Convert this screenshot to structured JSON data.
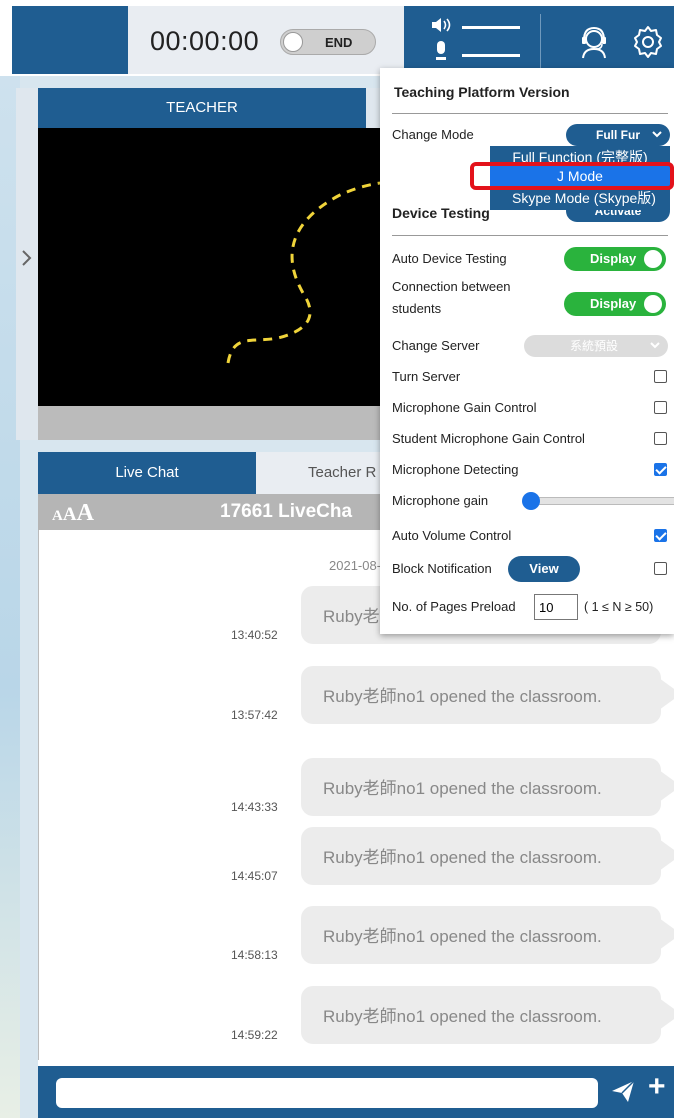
{
  "topbar": {
    "timer": "00:00:00",
    "end_label": "END"
  },
  "teacher": {
    "tab_label": "TEACHER"
  },
  "chat": {
    "tabs": [
      {
        "label": "Live Chat"
      },
      {
        "label": "Teacher R"
      }
    ],
    "font_size_label": [
      "A",
      "A",
      "A"
    ],
    "room_title": "17661 LiveCha",
    "date_stamp": "2021-08-",
    "messages": [
      {
        "time": "13:40:52",
        "text": "Ruby老"
      },
      {
        "time": "13:57:42",
        "text": "Ruby老師no1 opened the classroom."
      },
      {
        "time": "14:43:33",
        "text": "Ruby老師no1 opened the classroom."
      },
      {
        "time": "14:45:07",
        "text": "Ruby老師no1 opened the classroom."
      },
      {
        "time": "14:58:13",
        "text": "Ruby老師no1 opened the classroom."
      },
      {
        "time": "14:59:22",
        "text": "Ruby老師no1 opened the classroom."
      }
    ],
    "input_value": ""
  },
  "settings": {
    "header": "Teaching Platform Version",
    "change_mode": {
      "label": "Change Mode",
      "value": "Full Fur"
    },
    "mode_options": [
      {
        "label": "Full Function (完整版)"
      },
      {
        "label": "J Mode"
      },
      {
        "label": "Skype Mode (Skype版)"
      }
    ],
    "device_testing": {
      "label": "Device Testing",
      "button": "Activate"
    },
    "auto_device_testing": {
      "label": "Auto Device Testing",
      "toggle": "Display"
    },
    "connection_students": {
      "label_line1": "Connection between",
      "label_line2": "students",
      "toggle": "Display"
    },
    "change_server": {
      "label": "Change Server",
      "value": "系統預設"
    },
    "turn_server": {
      "label": "Turn Server",
      "checked": false
    },
    "mic_gain_control": {
      "label": "Microphone Gain Control",
      "checked": false
    },
    "student_mic_gain": {
      "label": "Student Microphone Gain Control",
      "checked": false
    },
    "mic_detecting": {
      "label": "Microphone Detecting",
      "checked": true
    },
    "mic_gain": {
      "label": "Microphone gain",
      "value": 0
    },
    "auto_volume": {
      "label": "Auto Volume Control",
      "checked": true
    },
    "block_notification": {
      "label": "Block Notification",
      "button": "View",
      "checked": false
    },
    "pages_preload": {
      "label": "No. of Pages Preload",
      "value": "10",
      "hint": "( 1 ≤ N ≥ 50)"
    }
  },
  "colors": {
    "primary": "#1f5d91",
    "toggle_on": "#2ab33d",
    "checkbox_on": "#1a73e8",
    "highlight_red": "#e3121b"
  }
}
